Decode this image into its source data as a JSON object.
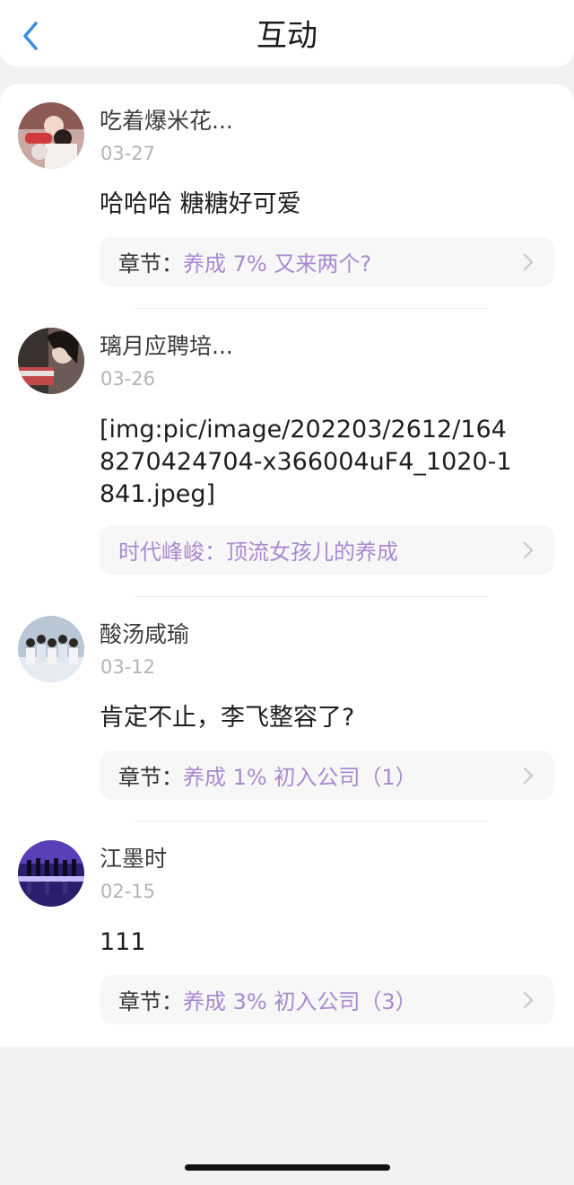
{
  "header": {
    "title": "互动",
    "back_icon": "chevron-left-icon",
    "back_color": "#3a8fe0"
  },
  "colors": {
    "accent_purple": "#a98ad0",
    "date_gray": "#b4b4b4"
  },
  "comments": [
    {
      "username": "吃着爆米花...",
      "date": "03-27",
      "text": "哈哈哈  糖糖好可爱",
      "chapter_prefix": "章节：",
      "chapter_title": "养成 7% 又来两个?"
    },
    {
      "username": "璃月应聘培...",
      "date": "03-26",
      "text": "[img:pic/image/202203/2612/1648270424704-x366004uF4_1020-1841.jpeg]",
      "chapter_prefix": "",
      "chapter_title": "时代峰峻：顶流女孩儿的养成"
    },
    {
      "username": "酸汤咸瑜",
      "date": "03-12",
      "text": "肯定不止，李飞整容了?",
      "chapter_prefix": "章节：",
      "chapter_title": "养成 1% 初入公司（1）"
    },
    {
      "username": "江墨时",
      "date": "02-15",
      "text": "111",
      "chapter_prefix": "章节：",
      "chapter_title": "养成 3% 初入公司（3）"
    }
  ]
}
